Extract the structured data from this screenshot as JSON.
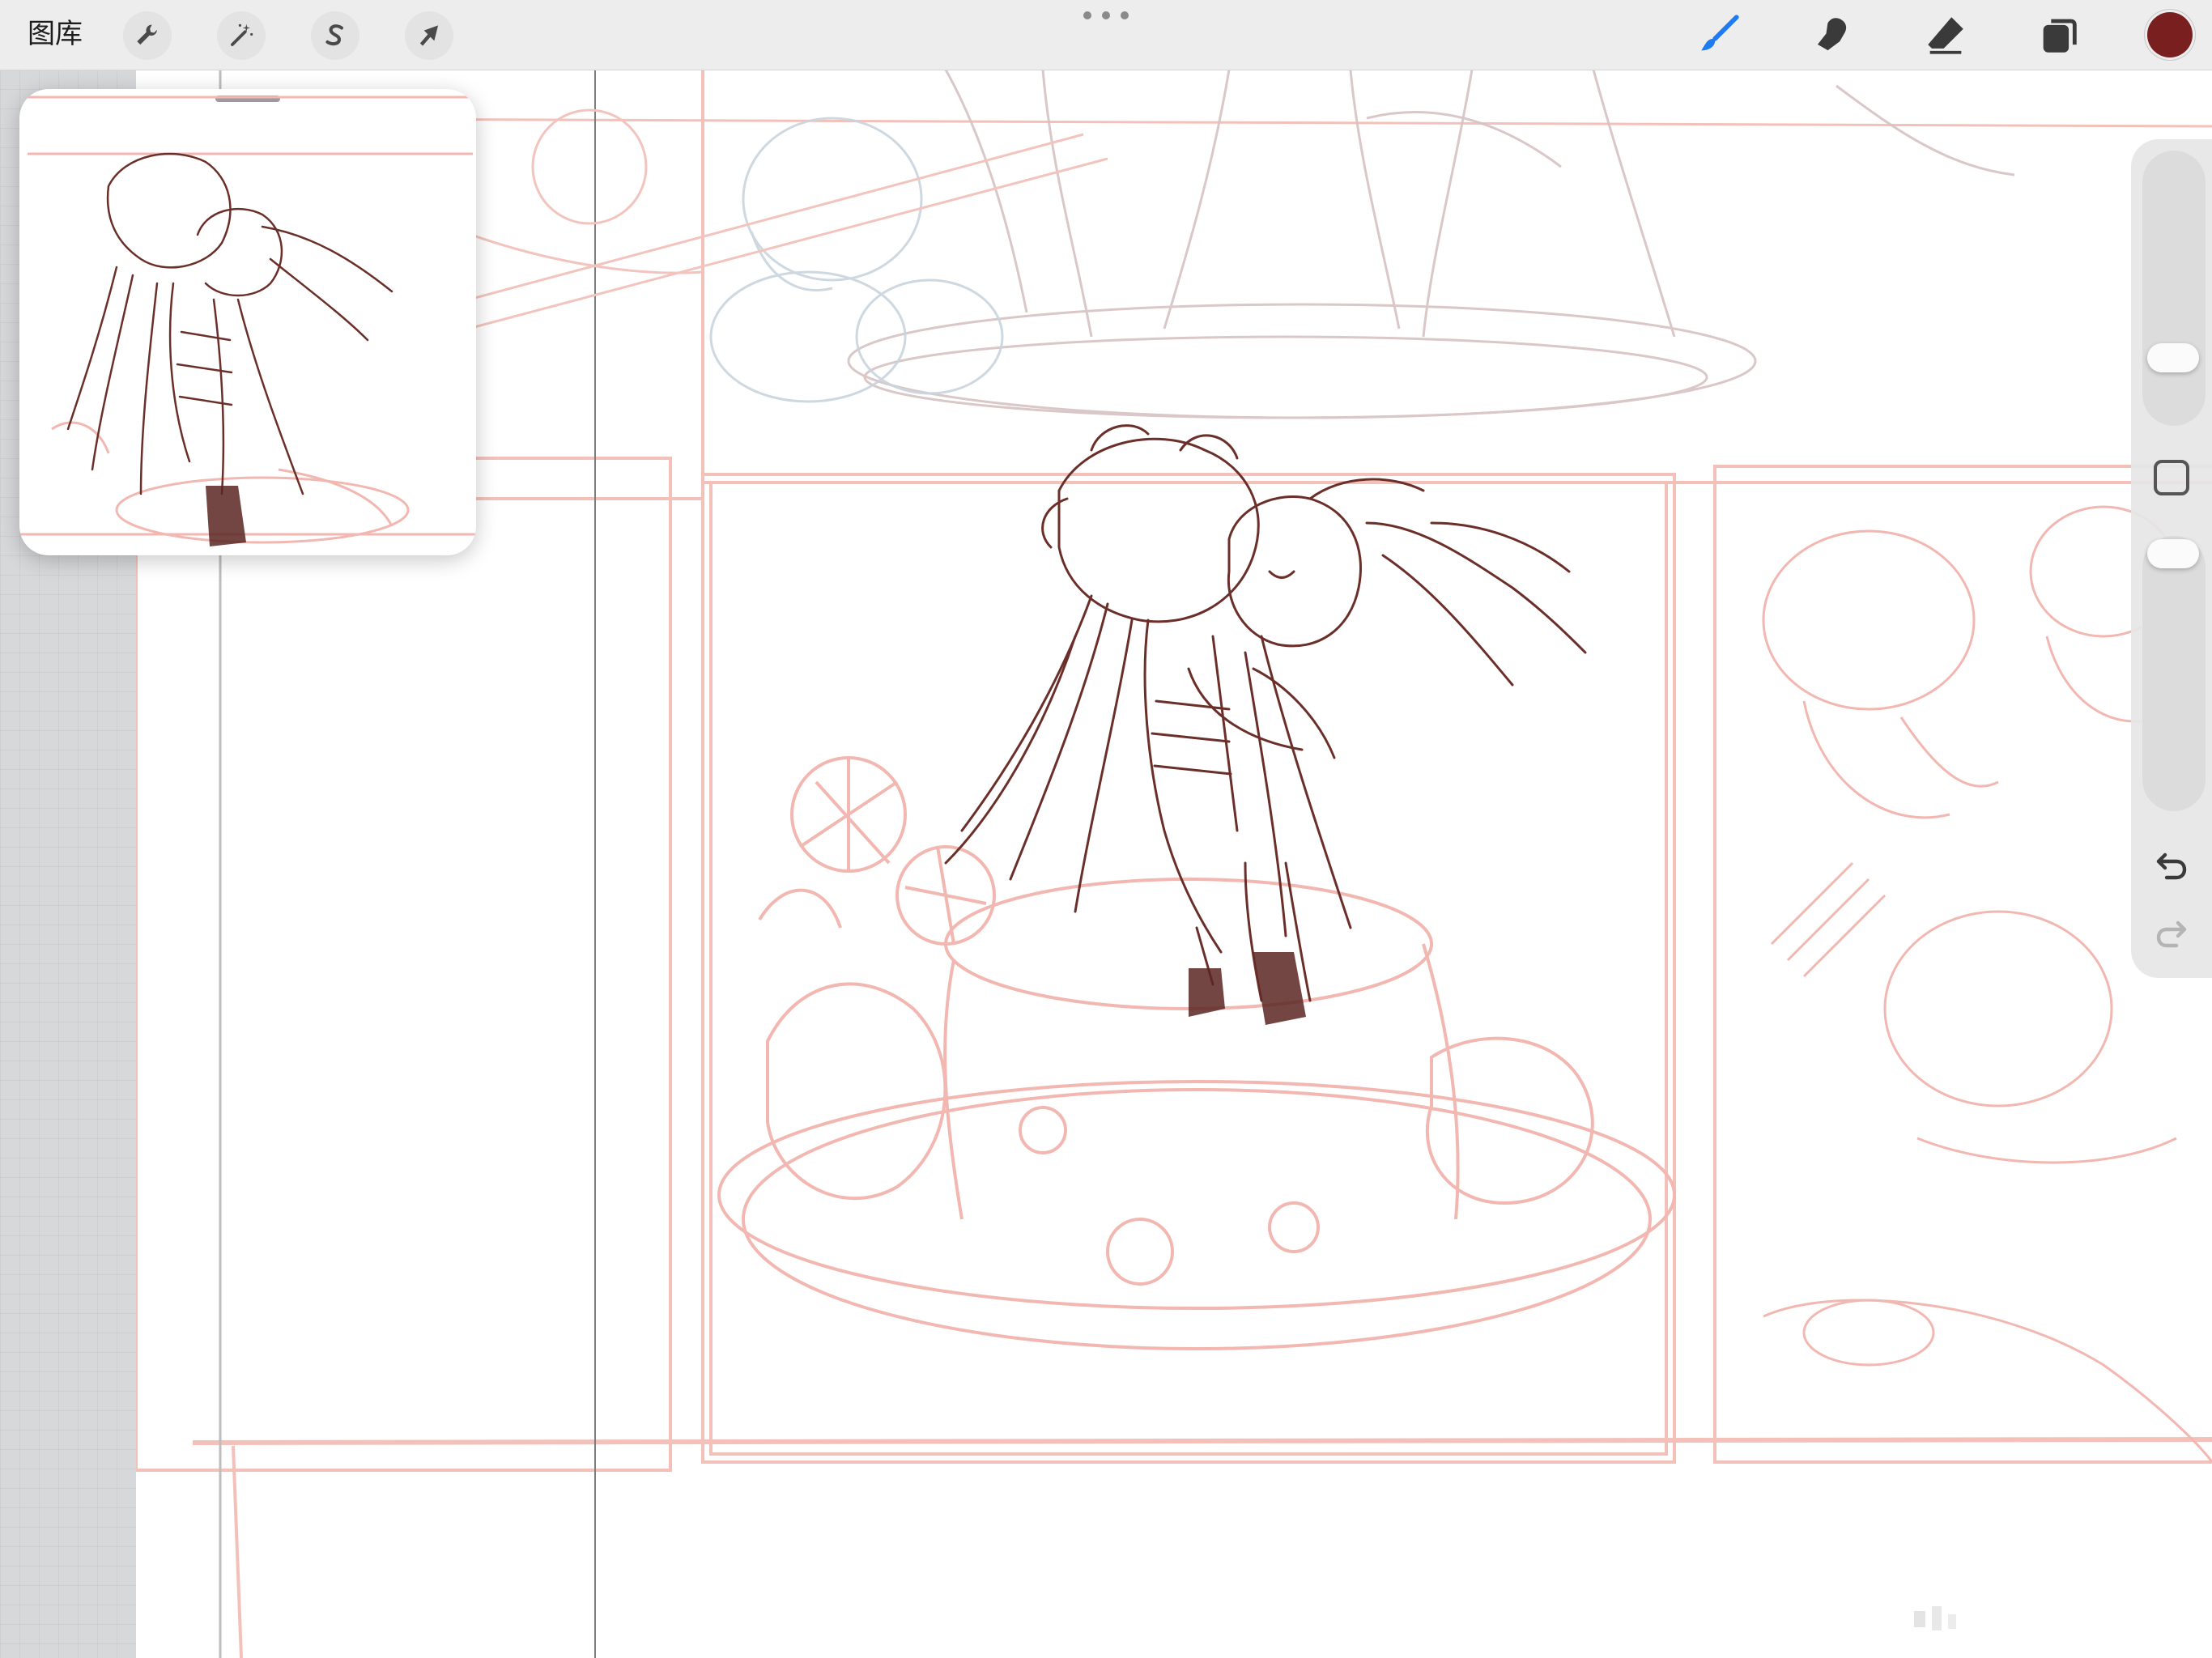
{
  "app": {
    "gallery_label": "图库"
  },
  "toolbar": {
    "left_tools": [
      {
        "name": "actions",
        "icon": "wrench-icon"
      },
      {
        "name": "adjustments",
        "icon": "magic-wand-icon"
      },
      {
        "name": "selection",
        "icon": "selection-s-icon"
      },
      {
        "name": "transform",
        "icon": "arrow-cursor-icon"
      }
    ],
    "right_tools": [
      {
        "name": "brush",
        "icon": "brush-icon",
        "active": true,
        "color": "#1e7cf0"
      },
      {
        "name": "smudge",
        "icon": "smudge-icon"
      },
      {
        "name": "eraser",
        "icon": "eraser-icon"
      },
      {
        "name": "layers",
        "icon": "layers-icon"
      }
    ],
    "current_color": "#7a1f1f",
    "more_icon": "ellipsis-icon"
  },
  "sidebar": {
    "brush_size_level": 0.25,
    "opacity_level": 0.05,
    "modify_icon": "square-icon",
    "undo_icon": "undo-icon",
    "redo_icon": "redo-icon"
  },
  "reference_window": {
    "grabber_icon": "drag-handle-icon"
  },
  "colors": {
    "sketch_dark": "#6b2f2a",
    "sketch_light": "#f2b7b0",
    "panel_line": "#f4c6c0",
    "toolbar_bg": "#ededed",
    "accent": "#1e7cf0"
  }
}
